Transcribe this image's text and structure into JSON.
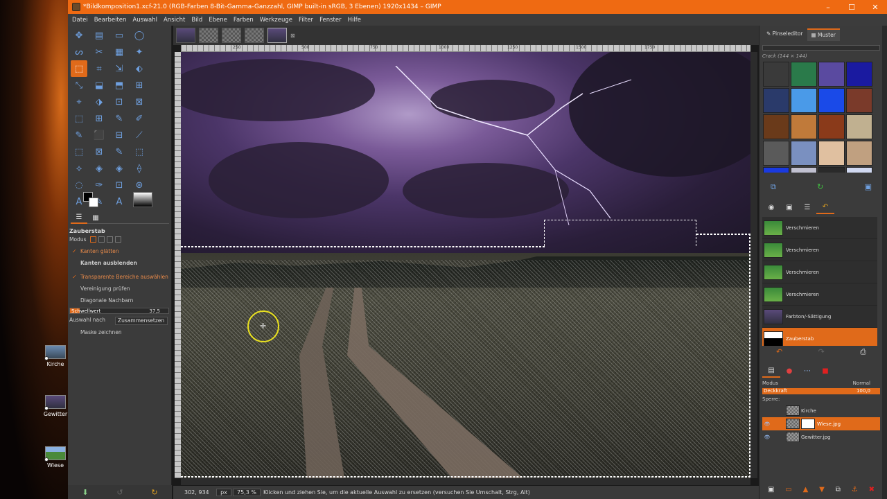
{
  "window": {
    "title": "*Bildkomposition1.xcf-21.0 (RGB-Farben 8-Bit-Gamma-Ganzzahl, GIMP built-in sRGB, 3 Ebenen) 1920x1434 – GIMP",
    "minimize": "–",
    "maximize": "☐",
    "close": "✕"
  },
  "menu": [
    "Datei",
    "Bearbeiten",
    "Auswahl",
    "Ansicht",
    "Bild",
    "Ebene",
    "Farben",
    "Werkzeuge",
    "Filter",
    "Fenster",
    "Hilfe"
  ],
  "desktop": {
    "icons": [
      {
        "label": "Kirche"
      },
      {
        "label": "Gewitter"
      },
      {
        "label": "Wiese"
      }
    ]
  },
  "toolbox": {
    "tools": [
      "✥",
      "▤",
      "▭",
      "◯",
      "ᔕ",
      "✂",
      "▦",
      "✦",
      "⬚",
      "⌗",
      "⇲",
      "⬖",
      "⤡",
      "⬓",
      "⬒",
      "⊞",
      "⌖",
      "⬗",
      "⊡",
      "⊠",
      "⬚",
      "⊞",
      "✎",
      "✐",
      "✎",
      "⬛",
      "⊟",
      "⟋",
      "⬚",
      "⊠",
      "✎",
      "⬚",
      "⟡",
      "◈",
      "◈",
      "⟠",
      "◌",
      "✑",
      "⊡",
      "⊛",
      "A",
      "✎",
      "A",
      "⊕"
    ],
    "active_tool_index": 8,
    "tool_options_title": "Zauberstab",
    "mode_label": "Modus",
    "options": [
      {
        "label": "Kanten glätten",
        "checked": true,
        "style": "orange"
      },
      {
        "label": "Kanten ausblenden",
        "checked": false,
        "style": "bold"
      },
      {
        "label": "Transparente Bereiche auswählen",
        "checked": true,
        "style": "orange"
      },
      {
        "label": "Vereinigung prüfen",
        "checked": false,
        "style": "normal"
      },
      {
        "label": "Diagonale Nachbarn",
        "checked": false,
        "style": "normal"
      }
    ],
    "threshold": {
      "label": "Schwellwert",
      "value": "37,5"
    },
    "select_by": {
      "label": "Auswahl nach",
      "value": "Zusammensetzen"
    },
    "draw_mask": "Maske zeichnen"
  },
  "ruler": {
    "labels": [
      "250",
      "500",
      "750",
      "1000",
      "1250",
      "1500",
      "1750"
    ]
  },
  "status": {
    "coords": "302, 934",
    "unit": "px",
    "zoom": "75,3 %",
    "message": "Klicken und ziehen Sie, um die aktuelle Auswahl zu ersetzen (versuchen Sie Umschalt, Strg, Alt)"
  },
  "dock": {
    "tabs": [
      "Pinseleditor",
      "Muster"
    ],
    "pattern_name": "Crack (144 × 144)",
    "patterns": [
      "#3a3a3a",
      "#2a7a4a",
      "#5a4aa0",
      "#1a1aa0",
      "#2a3a6a",
      "#4a9ae8",
      "#1a4ae8",
      "#7a3a2a",
      "#6a3a1a",
      "#c07a3a",
      "#8a3a1a",
      "#c0b090",
      "#5a5a5a",
      "#7a90c0",
      "#e0c0a0",
      "#c0a080",
      "#1a3ae0",
      "#c0c0d0",
      "#2a2a2a",
      "#d0d8f0"
    ],
    "history": [
      {
        "label": "Verschmieren",
        "thumb": "green",
        "selected": false
      },
      {
        "label": "Verschmieren",
        "thumb": "green",
        "selected": false
      },
      {
        "label": "Verschmieren",
        "thumb": "green",
        "selected": false
      },
      {
        "label": "Verschmieren",
        "thumb": "green",
        "selected": false
      },
      {
        "label": "Farbton/-Sättigung",
        "thumb": "dark",
        "selected": false
      },
      {
        "label": "Zauberstab",
        "thumb": "bw",
        "selected": true
      }
    ],
    "layers_panel": {
      "mode_label": "Modus",
      "mode_value": "Normal",
      "opacity_label": "Deckkraft",
      "opacity_value": "100,0",
      "lock_label": "Sperre:",
      "layers": [
        {
          "name": "Kirche",
          "visible": false,
          "selected": false,
          "mask": false
        },
        {
          "name": "Wiese.jpg",
          "visible": true,
          "selected": true,
          "mask": true
        },
        {
          "name": "Gewitter.jpg",
          "visible": true,
          "selected": false,
          "mask": false
        }
      ]
    }
  }
}
